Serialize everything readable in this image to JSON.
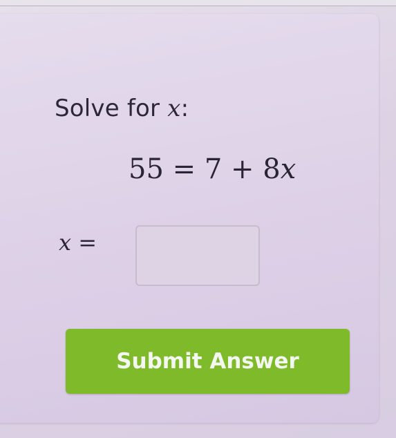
{
  "question": {
    "prompt_text": "Solve for ",
    "variable": "x",
    "prompt_suffix": ":",
    "equation": "55 = 7 + 8x",
    "equation_parts": {
      "left": "55",
      "equals": "=",
      "constant": "7",
      "plus": "+",
      "coefficient": "8",
      "variable": "x"
    }
  },
  "answer": {
    "label_variable": "x",
    "label_equals": "=",
    "input_value": "",
    "input_placeholder": ""
  },
  "submit": {
    "label": "Submit Answer"
  },
  "colors": {
    "accent_button": "#7fba2a",
    "button_text": "#f3f7ef",
    "page_background": "#ddd2e4",
    "text": "#2a2535"
  }
}
